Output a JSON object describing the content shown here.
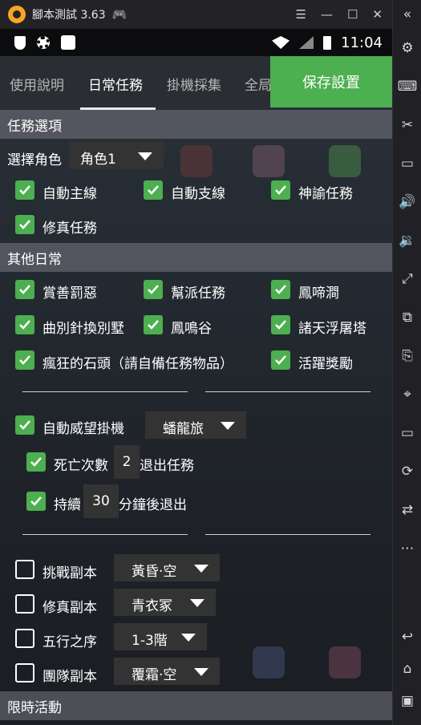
{
  "window": {
    "title": "腳本測試 3.63"
  },
  "statusbar": {
    "time": "11:04"
  },
  "tabs": [
    "使用說明",
    "日常任務",
    "掛機採集",
    "全局"
  ],
  "save_label": "保存設置",
  "sections": {
    "task_options": "任務選項",
    "other_daily": "其他日常",
    "limited": "限時活動"
  },
  "role": {
    "label": "選擇角色",
    "value": "角色1"
  },
  "tasks": [
    "自動主線",
    "自動支線",
    "神諭任務",
    "修真任務"
  ],
  "daily": [
    "賞善罰惡",
    "幫派任務",
    "鳳啼澗",
    "曲別針換別墅",
    "鳳鳴谷",
    "諸天浮屠塔",
    "瘋狂的石頭（請自備任務物品）",
    "活躍獎勵"
  ],
  "prestige": {
    "label": "自動威望掛機",
    "value": "蟠龍旅"
  },
  "death": {
    "pre": "死亡次數",
    "value": "2",
    "post": "退出任務"
  },
  "duration": {
    "pre": "持續",
    "value": "30",
    "post": "分鐘後退出"
  },
  "dungeons": [
    {
      "label": "挑戰副本",
      "value": "黃昏·空"
    },
    {
      "label": "修真副本",
      "value": "青衣冢"
    },
    {
      "label": "五行之序",
      "value": "1-3階"
    },
    {
      "label": "團隊副本",
      "value": "覆霜·空"
    }
  ]
}
